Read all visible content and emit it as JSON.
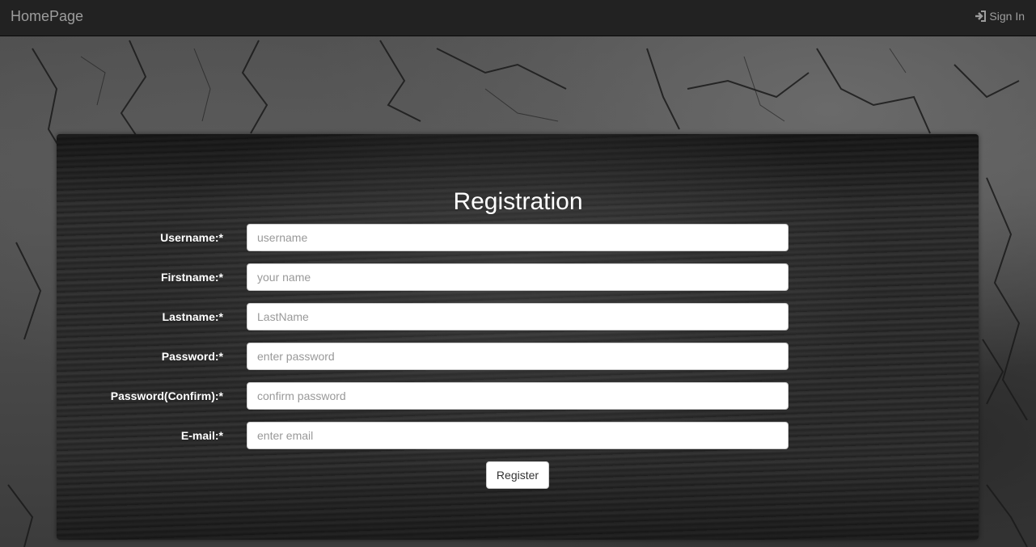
{
  "navbar": {
    "brand": "HomePage",
    "signin_label": "Sign In",
    "signin_icon": "log-in-icon"
  },
  "form": {
    "title": "Registration",
    "fields": [
      {
        "label": "Username:*",
        "placeholder": "username",
        "value": ""
      },
      {
        "label": "Firstname:*",
        "placeholder": "your name",
        "value": ""
      },
      {
        "label": "Lastname:*",
        "placeholder": "LastName",
        "value": ""
      },
      {
        "label": "Password:*",
        "placeholder": "enter password",
        "value": ""
      },
      {
        "label": "Password(Confirm):*",
        "placeholder": "confirm password",
        "value": ""
      },
      {
        "label": "E-mail:*",
        "placeholder": "enter email",
        "value": ""
      }
    ],
    "submit_label": "Register"
  },
  "colors": {
    "navbar_bg": "#222222",
    "navbar_text": "#9d9d9d",
    "label_text": "#ffffff",
    "input_bg": "#ffffff"
  }
}
